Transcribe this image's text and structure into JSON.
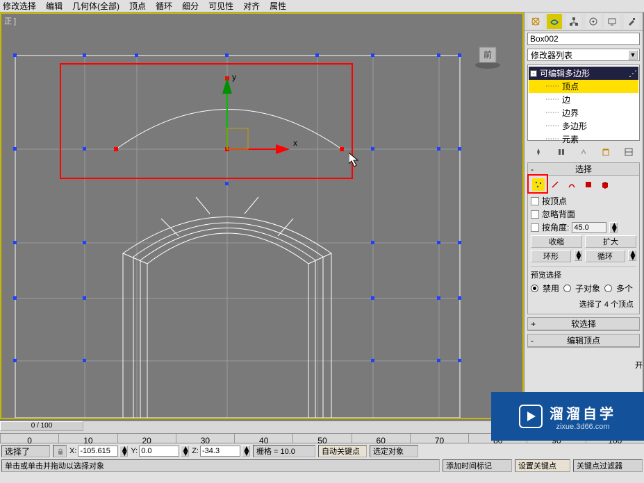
{
  "menu": [
    "修改选择",
    "编辑",
    "几何体(全部)",
    "顶点",
    "循环",
    "细分",
    "可见性",
    "对齐",
    "属性"
  ],
  "viewport_label": "正 ]",
  "viewcube_label": "前",
  "object_name": "Box002",
  "modifier_dropdown": "修改器列表",
  "stack": {
    "root": "可编辑多边形",
    "children": [
      "顶点",
      "边",
      "边界",
      "多边形",
      "元素"
    ],
    "selected_index": 0
  },
  "rollouts": {
    "selection_title": "选择",
    "soft_selection_title": "软选择",
    "edit_vertex_title": "编辑顶点"
  },
  "selection": {
    "by_vertex": "按顶点",
    "ignore_backfacing": "忽略背面",
    "by_angle": "按角度:",
    "angle_value": "45.0",
    "shrink": "收缩",
    "grow": "扩大",
    "ring": "环形",
    "loop": "循环",
    "preview_label": "预览选择",
    "radio_off": "禁用",
    "radio_subobj": "子对象",
    "radio_multi": "多个",
    "selected_text": "选择了 4 个顶点"
  },
  "timeline": {
    "frame_label": "0 / 100",
    "ticks": [
      "0",
      "10",
      "20",
      "30",
      "40",
      "50",
      "60",
      "70",
      "80",
      "90",
      "100"
    ]
  },
  "status": {
    "selected": "选择了",
    "front_lock": "",
    "x": "-105.615",
    "y": "0.0",
    "z": "-34.3",
    "grid": "栅格 = 10.0",
    "autokey": "自动关键点",
    "selset": "选定对象",
    "hint": "单击或单击并拖动以选择对象",
    "addtime": "添加时间标记",
    "setkey": "设置关键点",
    "keyfilter": "关键点过滤器"
  },
  "watermark": {
    "big": "溜溜自学",
    "small": "zixue.3d66.com"
  },
  "open_label": "开"
}
